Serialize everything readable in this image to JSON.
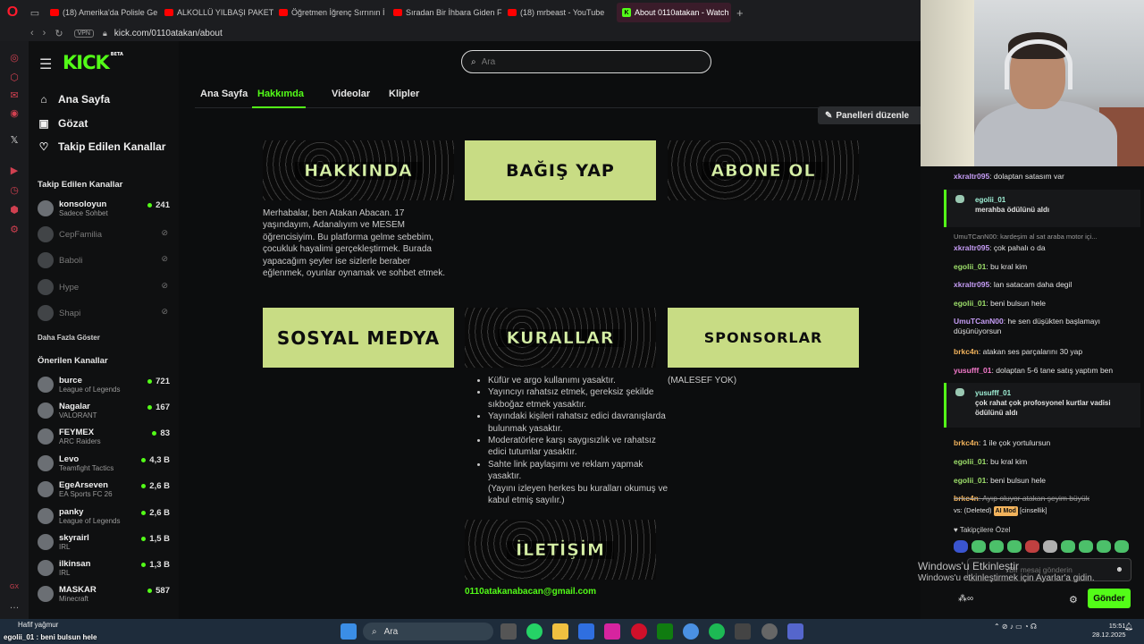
{
  "browser": {
    "tabs": [
      {
        "label": "(18) Amerika'da Polisle Ge",
        "active": false
      },
      {
        "label": "ALKOLLÜ YILBAŞI PAKETİ",
        "active": false
      },
      {
        "label": "Öğretmen İğrenç Sırrının İ",
        "active": false
      },
      {
        "label": "Sıradan Bir İhbara Giden F",
        "active": false
      },
      {
        "label": "(18) mrbeast - YouTube",
        "active": false
      },
      {
        "label": "About 0110atakan - Watch",
        "active": true
      }
    ],
    "vpn": "VPN",
    "url": "kick.com/0110atakan/about"
  },
  "kick": {
    "logo": "KICK",
    "logo_badge": "BETA",
    "search_placeholder": "Ara",
    "nav": [
      {
        "label": "Ana Sayfa",
        "icon": "home-icon"
      },
      {
        "label": "Gözat",
        "icon": "browse-icon"
      },
      {
        "label": "Takip Edilen Kanallar",
        "icon": "heart-icon"
      }
    ],
    "followed_title": "Takip Edilen Kanallar",
    "followed": [
      {
        "name": "konsoloyun",
        "sub": "Sadece Sohbet",
        "count": "241",
        "live": true
      },
      {
        "name": "CepFamilia",
        "sub": "",
        "count": "",
        "live": false
      },
      {
        "name": "Baboli",
        "sub": "",
        "count": "",
        "live": false
      },
      {
        "name": "Hype",
        "sub": "",
        "count": "",
        "live": false
      },
      {
        "name": "Shapi",
        "sub": "",
        "count": "",
        "live": false
      }
    ],
    "show_more": "Daha Fazla Göster",
    "recommended_title": "Önerilen Kanallar",
    "recommended": [
      {
        "name": "burce",
        "sub": "League of Legends",
        "count": "721"
      },
      {
        "name": "Nagalar",
        "sub": "VALORANT",
        "count": "167"
      },
      {
        "name": "FEYMEX",
        "sub": "ARC Raiders",
        "count": "83"
      },
      {
        "name": "Levo",
        "sub": "Teamfight Tactics",
        "count": "4,3 B"
      },
      {
        "name": "EgeArseven",
        "sub": "EA Sports FC 26",
        "count": "2,6 B"
      },
      {
        "name": "panky",
        "sub": "League of Legends",
        "count": "2,6 B"
      },
      {
        "name": "skyrairl",
        "sub": "IRL",
        "count": "1,5 B"
      },
      {
        "name": "ilkinsan",
        "sub": "IRL",
        "count": "1,3 B"
      },
      {
        "name": "MASKAR",
        "sub": "Minecraft",
        "count": "587"
      }
    ],
    "page_tabs": [
      "Ana Sayfa",
      "Hakkımda",
      "Videolar",
      "Klipler"
    ],
    "edit_panels": "Panelleri düzenle",
    "panels": {
      "hakkinda": "HAKKINDA",
      "bagis": "BAĞIŞ YAP",
      "abone": "ABONE OL",
      "sosyal": "SOSYAL MEDYA",
      "kurallar": "KURALLAR",
      "sponsorlar": "SPONSORLAR",
      "iletisim": "İLETİŞİM"
    },
    "about_text": "Merhabalar, ben Atakan Abacan. 17 yaşındayım, Adanalıyım ve MESEM öğrencisiyim. Bu platforma gelme sebebim, çocukluk hayalimi gerçekleştirmek. Burada yapacağım şeyler ise sizlerle beraber eğlenmek, oyunlar oynamak ve sohbet etmek.",
    "sponsor_text": "(MALESEF YOK)",
    "rules": [
      "Küfür ve argo kullanımı yasaktır.",
      "Yayıncıyı rahatsız etmek, gereksiz şekilde sıkboğaz etmek yasaktır.",
      "Yayındaki kişileri rahatsız edici davranışlarda bulunmak yasaktır.",
      "Moderatörlere karşı saygısızlık ve rahatsız edici tutumlar yasaktır.",
      "Sahte link paylaşımı ve reklam yapmak yasaktır."
    ],
    "rules_note": "(Yayını izleyen herkes bu kuralları okumuş ve kabul etmiş sayılır.)",
    "email": "0110atakanabacan@gmail.com"
  },
  "chat": {
    "m1": {
      "user": "xkraltr095",
      "text": ": dolaptan satasım var"
    },
    "r1": {
      "user": "egolii_01",
      "text": "merahba ödülünü aldı"
    },
    "reply1": "UmuTCanN00: kardeşim al sat araba motor içi...",
    "m2": {
      "user": "xkraltr095",
      "text": ": çok pahalı o da"
    },
    "m3": {
      "user": "egolii_01",
      "text": ": bu kral kim"
    },
    "m4": {
      "user": "xkraltr095",
      "text": ": lan satacam daha degil"
    },
    "m5": {
      "user": "egolii_01",
      "text": ": beni bulsun hele"
    },
    "m6": {
      "user": "UmuTCanN00",
      "text": ": he sen düşükten başlamayı düşünüyorsun"
    },
    "m7": {
      "user": "brkc4n",
      "text": ": atakan ses parçalarını 30 yap"
    },
    "m8": {
      "user": "yusufff_01",
      "text": ": dolaptan 5-6 tane satış yaptım ben"
    },
    "r2": {
      "user": "yusufff_01",
      "text": "çok rahat çok profosyonel kurtlar vadisi ödülünü aldı"
    },
    "m9": {
      "user": "brkc4n",
      "text": ": 1 ile çok yortulursun"
    },
    "m10": {
      "user": "egolii_01",
      "text": ": bu kral kim"
    },
    "m11": {
      "user": "egolii_01",
      "text": ": beni bulsun hele"
    },
    "m12": {
      "user": "brkc4n",
      "text": ": Ayıp oluyor atakan şeyim büyük"
    },
    "deleted": "vs: (Deleted)",
    "ai_mod": "AI Mod",
    "deleted_reason": "[cinsellik]",
    "followers_only": "Takipçilere Özel",
    "input_placeholder": "Bir mesaj gönderin",
    "send": "Gönder",
    "win_activate_title": "Windows'u Etkinleştir",
    "win_activate_sub": "Windows'u etkinleştirmek için Ayarlar'a gidin."
  },
  "taskbar": {
    "weather": "Hafif yağmur",
    "search": "Ara",
    "time": "15:51",
    "date": "28.12.2025",
    "caption": "egolii_01 : beni bulsun hele"
  },
  "colors": {
    "accent": "#53fc18",
    "panel_lime": "#c8dc84",
    "bg": "#0c0d0e"
  }
}
